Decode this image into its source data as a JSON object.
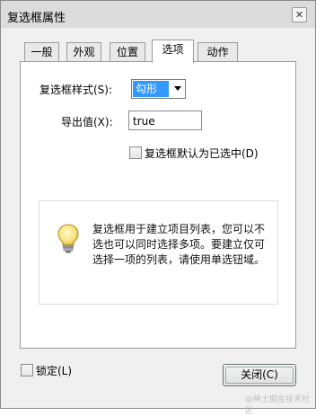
{
  "window": {
    "title": "复选框属性",
    "close_glyph": "✕"
  },
  "tabs": [
    {
      "label": "一般"
    },
    {
      "label": "外观"
    },
    {
      "label": "位置"
    },
    {
      "label": "选项",
      "active": true
    },
    {
      "label": "动作"
    }
  ],
  "options": {
    "style_label": "复选框样式(S):",
    "style_value": "勾形",
    "export_label": "导出值(X):",
    "export_value": "true",
    "default_checked_label": "复选框默认为已选中(D)",
    "default_checked": false
  },
  "info": {
    "icon": "lightbulb-icon",
    "text": "复选框用于建立项目列表，您可以不选也可以同时选择多项。要建立仅可选择一项的列表，请使用单选钮域。"
  },
  "footer": {
    "lock_label": "锁定(L)",
    "locked": false,
    "close_button_label": "关闭(C)"
  },
  "watermark": "@稀土掘金技术社区"
}
